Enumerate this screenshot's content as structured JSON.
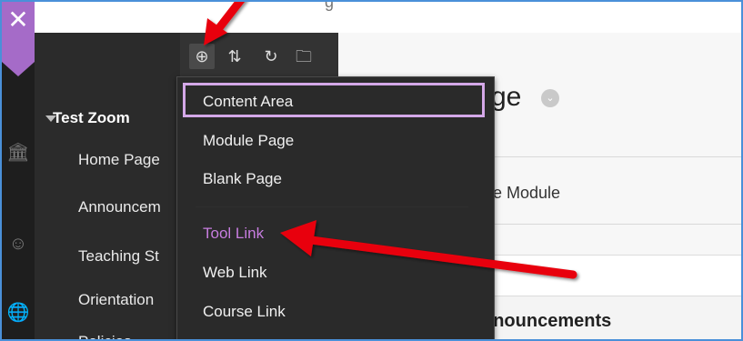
{
  "window": {
    "partial_title": "g"
  },
  "colors": {
    "accent": "#a56bc8",
    "panel_bg": "#2b2b2b",
    "highlight_border": "#d4a8e8",
    "arrow": "#e8000b",
    "frame_border": "#4a90d9"
  },
  "rail": {
    "close_icon": "close-x-icon",
    "icons": [
      "institution-icon",
      "user-icon",
      "globe-icon"
    ]
  },
  "toolbar": {
    "buttons": [
      {
        "icon": "add-circle-icon",
        "glyph": "⊕"
      },
      {
        "icon": "sort-arrows-icon",
        "glyph": "⇅"
      },
      {
        "icon": "refresh-icon",
        "glyph": "↻"
      },
      {
        "icon": "folder-icon",
        "glyph": "🗀"
      }
    ]
  },
  "course_menu": {
    "course_title": "Test Zoom",
    "items": [
      "Home Page",
      "Announcem",
      "Teaching St",
      "Orientation",
      "Policies"
    ]
  },
  "dropdown": {
    "items": [
      {
        "label": "Content Area",
        "style": "highlighted"
      },
      {
        "label": "Module Page",
        "style": "normal"
      },
      {
        "label": "Blank Page",
        "style": "normal"
      },
      {
        "label": "Tool Link",
        "style": "purple"
      },
      {
        "label": "Web Link",
        "style": "normal"
      },
      {
        "label": "Course Link",
        "style": "normal"
      }
    ]
  },
  "content": {
    "page_title_fragment": "ge",
    "module_label_fragment": "e Module",
    "announcements_fragment": "nnouncements"
  }
}
